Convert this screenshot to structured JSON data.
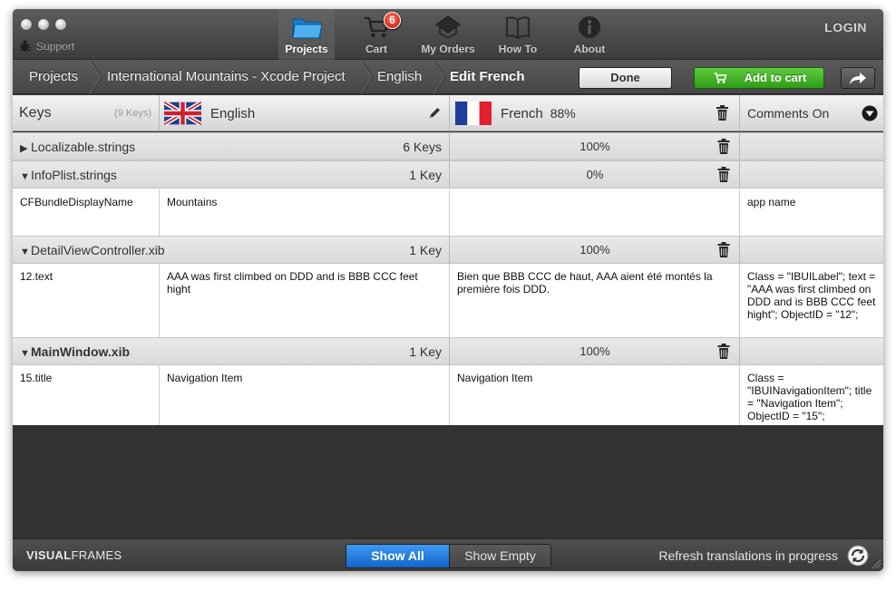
{
  "toolbar": {
    "support": "Support",
    "items": [
      {
        "label": "Projects"
      },
      {
        "label": "Cart"
      },
      {
        "label": "My Orders"
      },
      {
        "label": "How To"
      },
      {
        "label": "About"
      }
    ],
    "cart_badge": "6",
    "login": "LOGIN"
  },
  "breadcrumb": {
    "items": [
      "Projects",
      "International Mountains - Xcode Project",
      "English",
      "Edit French"
    ],
    "done": "Done",
    "add_to_cart": "Add to cart"
  },
  "columns": {
    "keys": "Keys",
    "keys_count": "(9 Keys)",
    "source_lang": "English",
    "target_lang": "French",
    "target_pct": "88%",
    "comments": "Comments On"
  },
  "groups": [
    {
      "name": "Localizable.strings",
      "count": "6 Keys",
      "pct": "100%",
      "expanded": false,
      "rows": []
    },
    {
      "name": "InfoPlist.strings",
      "count": "1 Key",
      "pct": "0%",
      "expanded": true,
      "rows": [
        {
          "key": "CFBundleDisplayName",
          "source": "Mountains",
          "target": "",
          "comment": "app name"
        }
      ]
    },
    {
      "name": "DetailViewController.xib",
      "count": "1 Key",
      "pct": "100%",
      "expanded": true,
      "rows": [
        {
          "key": "12.text",
          "source": "AAA was first climbed on DDD and is BBB CCC feet hight",
          "target": "Bien que BBB CCC de haut, AAA aient été montés la première fois DDD.",
          "comment": " Class = \"IBUILabel\"; text = \"AAA was first climbed on DDD and is BBB CCC feet hight\"; ObjectID = \"12\";"
        }
      ]
    },
    {
      "name": "MainWindow.xib",
      "count": "1 Key",
      "pct": "100%",
      "expanded": true,
      "rows": [
        {
          "key": "15.title",
          "source": "Navigation Item",
          "target": "Navigation Item",
          "comment": " Class = \"IBUINavigationItem\"; title = \"Navigation Item\"; ObjectID = \"15\";"
        }
      ]
    }
  ],
  "footer": {
    "brand_bold": "VISUAL",
    "brand_light": "FRAMES",
    "show_all": "Show All",
    "show_empty": "Show Empty",
    "status": "Refresh translations in progress"
  },
  "colors": {
    "accent_blue": "#1f7ee0",
    "cart_green": "#3fae22",
    "badge_red": "#d8221a"
  }
}
